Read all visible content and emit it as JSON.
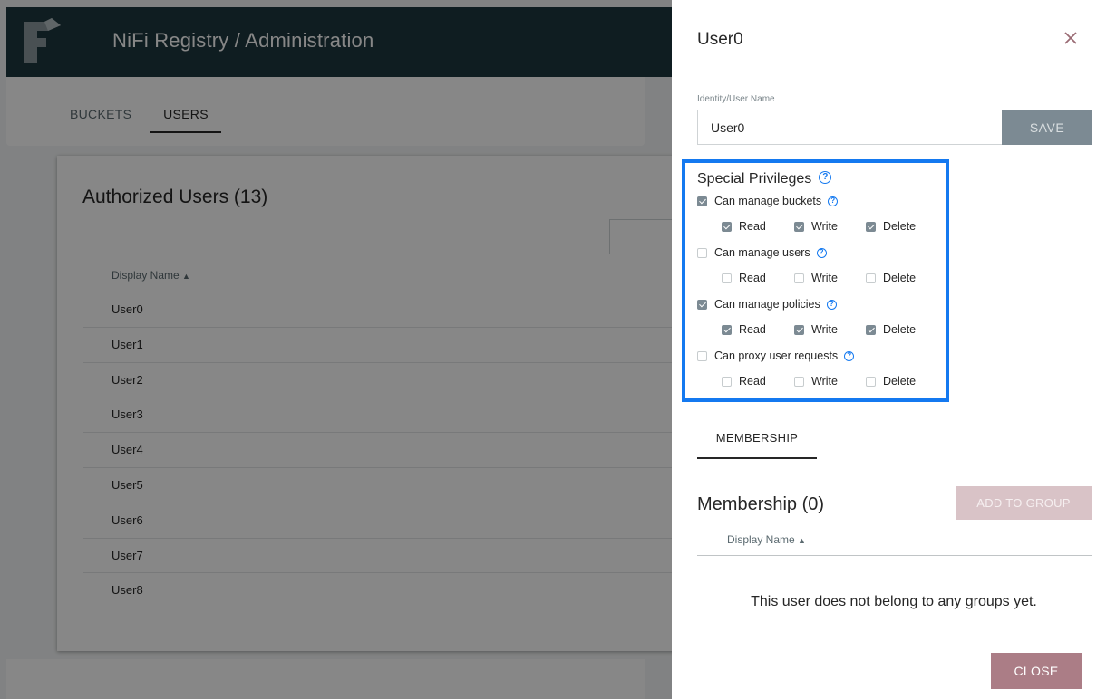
{
  "app": {
    "title": "NiFi Registry / Administration",
    "tabs": [
      {
        "label": "BUCKETS"
      },
      {
        "label": "USERS"
      }
    ],
    "users_card": {
      "title": "Authorized Users (13)",
      "column_header": "Display Name",
      "sort_indicator": "▲",
      "rows": [
        "User0",
        "User1",
        "User2",
        "User3",
        "User4",
        "User5",
        "User6",
        "User7",
        "User8"
      ]
    }
  },
  "panel": {
    "title": "User0",
    "identity_label": "Identity/User Name",
    "identity_value": "User0",
    "save_label": "SAVE",
    "special_privileges": {
      "title": "Special Privileges",
      "help_glyph": "?",
      "groups": [
        {
          "label": "Can manage buckets",
          "checked": true,
          "perms": [
            {
              "label": "Read",
              "checked": true
            },
            {
              "label": "Write",
              "checked": true
            },
            {
              "label": "Delete",
              "checked": true
            }
          ]
        },
        {
          "label": "Can manage users",
          "checked": false,
          "perms": [
            {
              "label": "Read",
              "checked": false
            },
            {
              "label": "Write",
              "checked": false
            },
            {
              "label": "Delete",
              "checked": false
            }
          ]
        },
        {
          "label": "Can manage policies",
          "checked": true,
          "perms": [
            {
              "label": "Read",
              "checked": true
            },
            {
              "label": "Write",
              "checked": true
            },
            {
              "label": "Delete",
              "checked": true
            }
          ]
        },
        {
          "label": "Can proxy user requests",
          "checked": false,
          "perms": [
            {
              "label": "Read",
              "checked": false
            },
            {
              "label": "Write",
              "checked": false
            },
            {
              "label": "Delete",
              "checked": false
            }
          ]
        }
      ]
    },
    "membership_tab": "MEMBERSHIP",
    "membership_title": "Membership (0)",
    "add_to_group_label": "ADD TO GROUP",
    "membership_column_header": "Display Name",
    "sort_indicator": "▲",
    "empty_message": "This user does not belong to any groups yet.",
    "close_label": "CLOSE"
  },
  "colors": {
    "header_bg": "#1e373f",
    "highlight_border": "#1479f0",
    "close_button": "#ab7d86",
    "add_group_button_disabled": "#d9c3c7",
    "save_button": "#7c8a93"
  },
  "icons": {
    "logo": "nifi-registry-logo-icon",
    "close": "close-icon",
    "help": "help-icon",
    "checkbox": "checkbox-icon"
  }
}
